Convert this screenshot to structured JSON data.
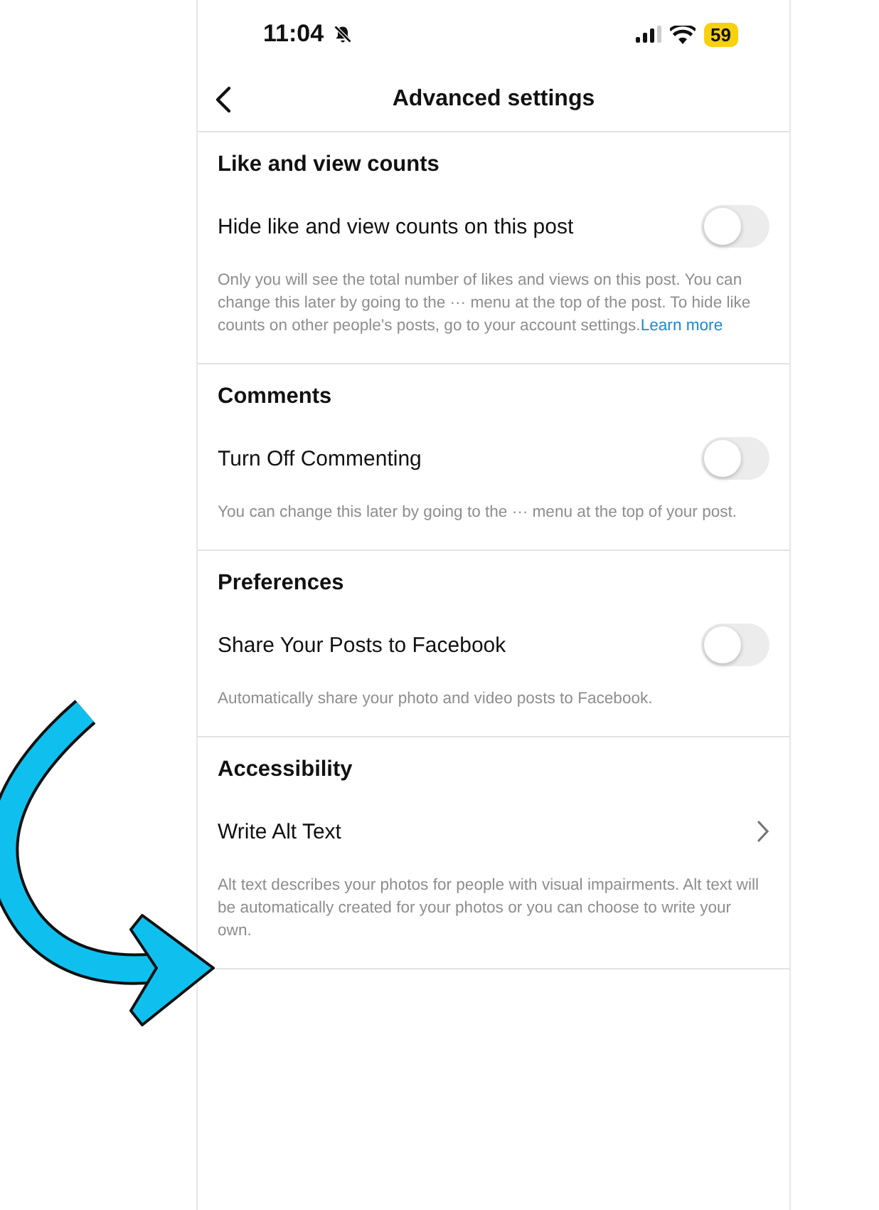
{
  "status_bar": {
    "time": "11:04",
    "battery": "59"
  },
  "header": {
    "title": "Advanced settings"
  },
  "sections": [
    {
      "title": "Like and view counts",
      "row": {
        "kind": "toggle",
        "label": "Hide like and view counts on this post",
        "on": false
      },
      "description": "Only you will see the total number of likes and views on this post. You can change this later by going to the ··· menu at the top of the post. To hide like counts on other people's posts, go to your account settings.",
      "link": "Learn more"
    },
    {
      "title": "Comments",
      "row": {
        "kind": "toggle",
        "label": "Turn Off Commenting",
        "on": false
      },
      "description": "You can change this later by going to the ··· menu at the top of your post."
    },
    {
      "title": "Preferences",
      "row": {
        "kind": "toggle",
        "label": "Share Your Posts to Facebook",
        "on": false
      },
      "description": "Automatically share your photo and video posts to Facebook."
    },
    {
      "title": "Accessibility",
      "row": {
        "kind": "chevron",
        "label": "Write Alt Text"
      },
      "description": "Alt text describes your photos for people with visual impairments. Alt text will be automatically created for your photos or you can choose to write your own."
    }
  ]
}
